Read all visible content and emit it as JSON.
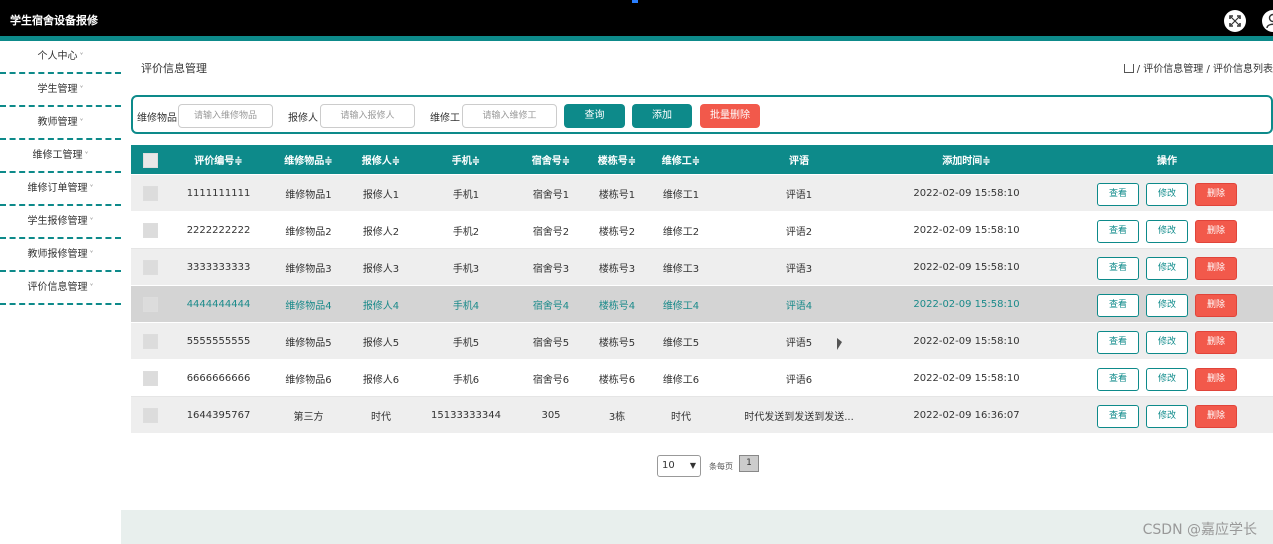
{
  "app": {
    "title": "学生宿舍设备报修"
  },
  "sidebar": {
    "items": [
      {
        "label": "个人中心"
      },
      {
        "label": "学生管理"
      },
      {
        "label": "教师管理"
      },
      {
        "label": "维修工管理"
      },
      {
        "label": "维修订单管理"
      },
      {
        "label": "学生报修管理"
      },
      {
        "label": "教师报修管理"
      },
      {
        "label": "评价信息管理"
      }
    ],
    "caret": "˅"
  },
  "page": {
    "title": "评价信息管理",
    "breadcrumb": "/ 评价信息管理 / 评价信息列表"
  },
  "search": {
    "item_label": "维修物品",
    "item_placeholder": "请输入维修物品",
    "reporter_label": "报修人",
    "reporter_placeholder": "请输入报修人",
    "worker_label": "维修工",
    "worker_placeholder": "请输入维修工",
    "query_btn": "查询",
    "add_btn": "添加",
    "batch_delete_btn": "批量删除"
  },
  "table": {
    "headers": {
      "id": "评价编号≑",
      "item": "维修物品≑",
      "reporter": "报修人≑",
      "phone": "手机≑",
      "dorm": "宿舍号≑",
      "building": "楼栋号≑",
      "worker": "维修工≑",
      "comment": "评语",
      "time": "添加时间≑",
      "ops": "操作"
    },
    "rows": [
      {
        "id": "1111111111",
        "item": "维修物品1",
        "reporter": "报修人1",
        "phone": "手机1",
        "dorm": "宿舍号1",
        "building": "楼栋号1",
        "worker": "维修工1",
        "comment": "评语1",
        "time": "2022-02-09 15:58:10"
      },
      {
        "id": "2222222222",
        "item": "维修物品2",
        "reporter": "报修人2",
        "phone": "手机2",
        "dorm": "宿舍号2",
        "building": "楼栋号2",
        "worker": "维修工2",
        "comment": "评语2",
        "time": "2022-02-09 15:58:10"
      },
      {
        "id": "3333333333",
        "item": "维修物品3",
        "reporter": "报修人3",
        "phone": "手机3",
        "dorm": "宿舍号3",
        "building": "楼栋号3",
        "worker": "维修工3",
        "comment": "评语3",
        "time": "2022-02-09 15:58:10"
      },
      {
        "id": "4444444444",
        "item": "维修物品4",
        "reporter": "报修人4",
        "phone": "手机4",
        "dorm": "宿舍号4",
        "building": "楼栋号4",
        "worker": "维修工4",
        "comment": "评语4",
        "time": "2022-02-09 15:58:10"
      },
      {
        "id": "5555555555",
        "item": "维修物品5",
        "reporter": "报修人5",
        "phone": "手机5",
        "dorm": "宿舍号5",
        "building": "楼栋号5",
        "worker": "维修工5",
        "comment": "评语5",
        "time": "2022-02-09 15:58:10"
      },
      {
        "id": "6666666666",
        "item": "维修物品6",
        "reporter": "报修人6",
        "phone": "手机6",
        "dorm": "宿舍号6",
        "building": "楼栋号6",
        "worker": "维修工6",
        "comment": "评语6",
        "time": "2022-02-09 15:58:10"
      },
      {
        "id": "1644395767",
        "item": "第三方",
        "reporter": "时代",
        "phone": "15133333344",
        "dorm": "305",
        "building": "3栋",
        "worker": "时代",
        "comment": "时代发送到发送到发送...",
        "time": "2022-02-09 16:36:07"
      }
    ],
    "actions": {
      "view": "查看",
      "edit": "修改",
      "delete": "删除"
    }
  },
  "pager": {
    "page_size": "10",
    "per_page_label": "条每页",
    "current_page": "1"
  },
  "watermark": "CSDN @嘉应学长",
  "colors": {
    "accent": "#0d8a8a",
    "danger": "#f2594b",
    "topbar": "#000000"
  }
}
